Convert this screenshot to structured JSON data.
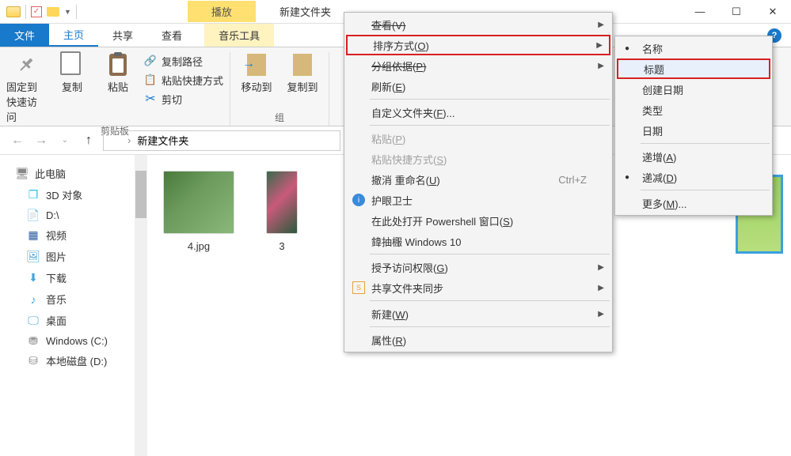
{
  "titlebar": {
    "context_tab": "播放",
    "window_title": "新建文件夹"
  },
  "win_controls": {
    "min": "—",
    "max": "☐",
    "close": "✕"
  },
  "ribbon_tabs": {
    "file": "文件",
    "home": "主页",
    "share": "共享",
    "view": "查看",
    "music": "音乐工具"
  },
  "ribbon": {
    "pin": "固定到快速访问",
    "copy": "复制",
    "paste": "粘贴",
    "copy_path": "复制路径",
    "paste_shortcut": "粘贴快捷方式",
    "cut": "剪切",
    "group_clipboard": "剪贴板",
    "move_to": "移动到",
    "copy_to": "复制到",
    "group_organize_partial": "组"
  },
  "address": {
    "folder": "新建文件夹",
    "sep": "›"
  },
  "sidebar": {
    "this_pc": "此电脑",
    "objects3d": "3D 对象",
    "d_drive": "D:\\",
    "video": "视频",
    "pictures": "图片",
    "downloads": "下载",
    "music": "音乐",
    "desktop": "桌面",
    "win_c": "Windows (C:)",
    "local_d": "本地磁盘 (D:)"
  },
  "files": {
    "f1": "4.jpg",
    "f2_partial": "3"
  },
  "context_menu": {
    "view": "查看(V)",
    "sort": "排序方式(O)",
    "group": "分组依据(P)",
    "refresh": "刷新(E)",
    "customize": "自定义文件夹(F)...",
    "paste": "粘贴(P)",
    "paste_shortcut": "粘贴快捷方式(S)",
    "undo_rename": "撤消 重命名(U)",
    "undo_shortcut": "Ctrl+Z",
    "eye_guard": "护眼卫士",
    "open_powershell": "在此处打开 Powershell 窗口(S)",
    "restore_win10": "鍏抽棴 Windows 10",
    "grant_access": "授予访问权限(G)",
    "share_sync": "共享文件夹同步",
    "new": "新建(W)",
    "properties": "属性(R)"
  },
  "sort_submenu": {
    "name": "名称",
    "title": "标题",
    "created": "创建日期",
    "type": "类型",
    "date": "日期",
    "ascending": "递增(A)",
    "descending": "递减(D)",
    "more": "更多(M)..."
  }
}
